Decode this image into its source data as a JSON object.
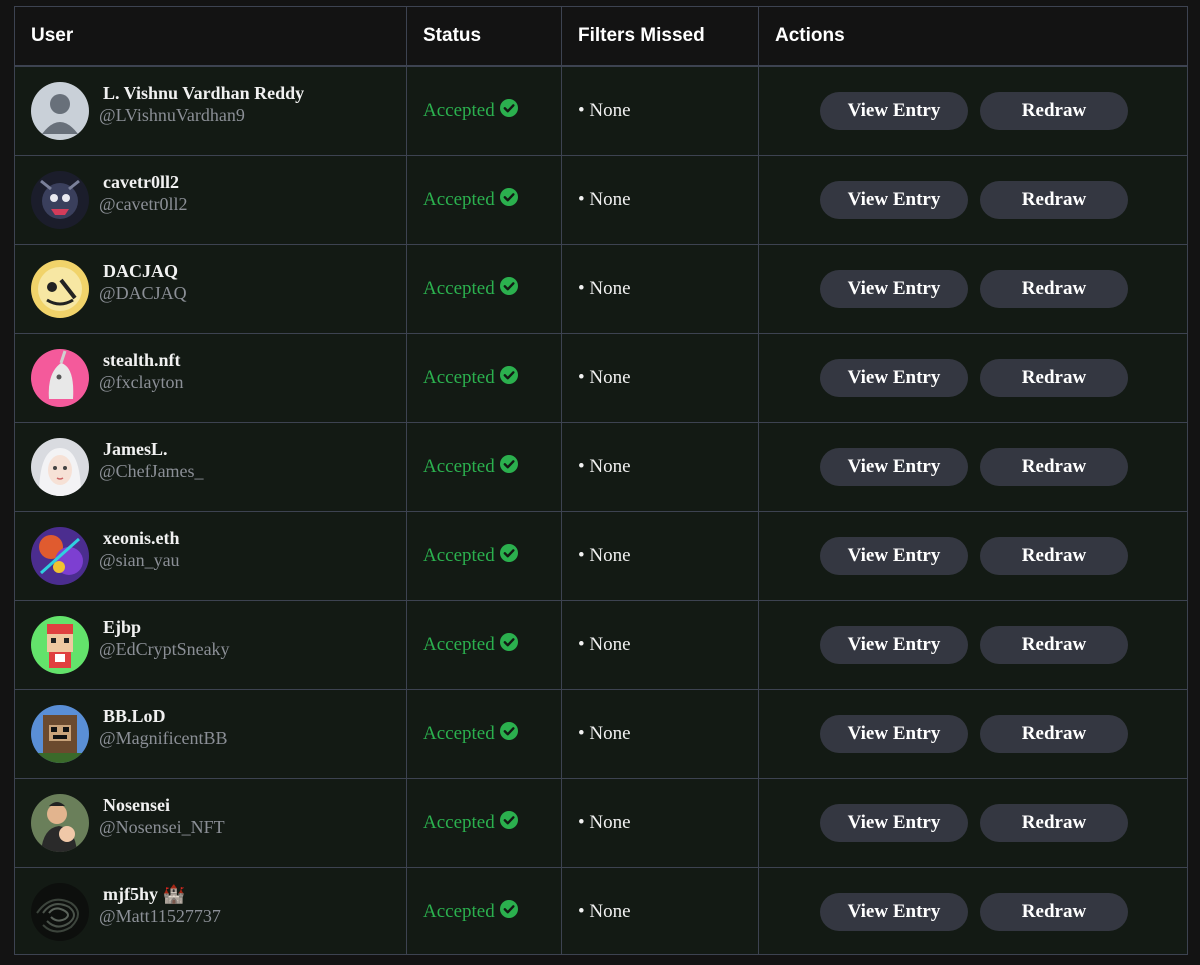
{
  "headers": {
    "user": "User",
    "status": "Status",
    "filters": "Filters Missed",
    "actions": "Actions"
  },
  "buttons": {
    "view_entry": "View Entry",
    "redraw": "Redraw"
  },
  "colors": {
    "accepted": "#2bb04e",
    "button_bg": "#343741",
    "row_bg": "#131a14",
    "border": "#3d4351"
  },
  "rows": [
    {
      "name": "L. Vishnu Vardhan Reddy",
      "handle": "@LVishnuVardhan9",
      "status": "Accepted",
      "filters": "• None",
      "avatar": "default-avatar"
    },
    {
      "name": "cavetr0ll2",
      "handle": "@cavetr0ll2",
      "status": "Accepted",
      "filters": "• None",
      "avatar": "dark-creature-avatar"
    },
    {
      "name": "DACJAQ",
      "handle": "@DACJAQ",
      "status": "Accepted",
      "filters": "• None",
      "avatar": "yellow-cartoon-avatar"
    },
    {
      "name": "stealth.nft",
      "handle": "@fxclayton",
      "status": "Accepted",
      "filters": "• None",
      "avatar": "pink-unicorn-avatar"
    },
    {
      "name": "JamesL.",
      "handle": "@ChefJames_",
      "status": "Accepted",
      "filters": "• None",
      "avatar": "anime-girl-avatar"
    },
    {
      "name": "xeonis.eth",
      "handle": "@sian_yau",
      "status": "Accepted",
      "filters": "• None",
      "avatar": "purple-art-avatar"
    },
    {
      "name": "Ejbp",
      "handle": "@EdCryptSneaky",
      "status": "Accepted",
      "filters": "• None",
      "avatar": "pixel-character-avatar"
    },
    {
      "name": "BB.LoD",
      "handle": "@MagnificentBB",
      "status": "Accepted",
      "filters": "• None",
      "avatar": "pixel-ape-avatar"
    },
    {
      "name": "Nosensei",
      "handle": "@Nosensei_NFT",
      "status": "Accepted",
      "filters": "• None",
      "avatar": "person-with-baby-avatar"
    },
    {
      "name": "mjf5hy 🏰",
      "handle": "@Matt11527737",
      "status": "Accepted",
      "filters": "• None",
      "avatar": "dark-swirl-avatar"
    }
  ]
}
